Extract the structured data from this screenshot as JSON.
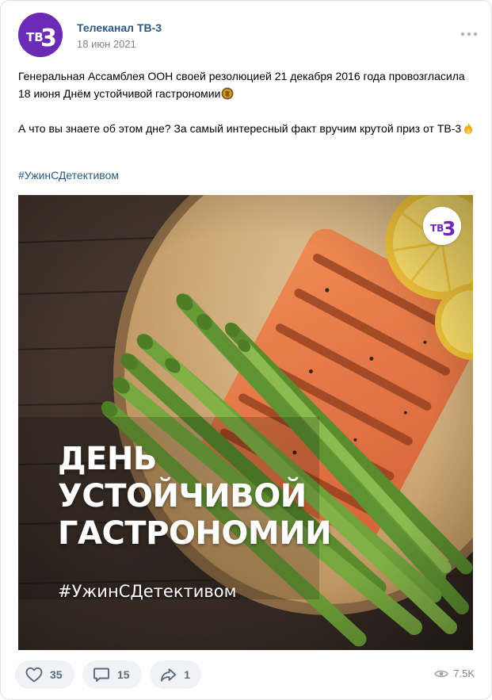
{
  "post": {
    "author": "Телеканал ТВ-3",
    "date": "18 июн 2021",
    "avatar_text": "ТВ3",
    "paragraph1": "Генеральная Ассамблея ООН своей резолюцией 21 декабря 2016 года провозгласила 18 июня Днём устойчивой гастрономии",
    "paragraph2": "А что вы знаете об этом дне? За самый интересный факт вручим крутой приз от ТВ-3",
    "hashtag": "#УжинСДетективом"
  },
  "image": {
    "headline_line1": "ДЕНЬ",
    "headline_line2": "УСТОЙЧИВОЙ",
    "headline_line3": "ГАСТРОНОМИИ",
    "hashtag": "#УжинСДетективом",
    "logo_text": "ТВ3"
  },
  "actions": {
    "likes": "35",
    "comments": "15",
    "shares": "1",
    "views": "7.5K"
  },
  "colors": {
    "brand_purple": "#6b2bb5",
    "link_blue": "#2a5885",
    "button_bg": "#f0f2f5",
    "icon_gray": "#5a6b7e"
  },
  "icons": {
    "more": "more-dots-icon",
    "like": "heart-icon",
    "comment": "comment-icon",
    "share": "share-icon",
    "views": "eye-icon",
    "emoji1": "globe-food-emoji-icon",
    "emoji2": "fire-emoji-icon"
  }
}
